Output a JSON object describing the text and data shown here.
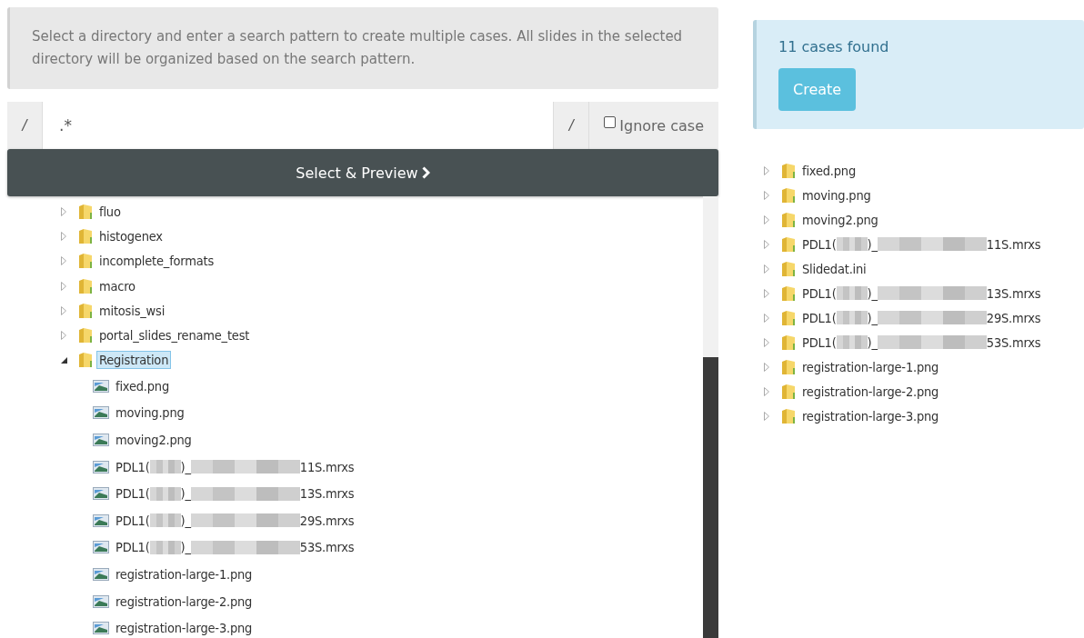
{
  "intro": {
    "text": "Select a directory and enter a search pattern to create multiple cases. All slides in the selected directory will be organized based on the search pattern."
  },
  "pattern": {
    "prefix": "/",
    "value": ".*",
    "suffix": "/",
    "ignore_case": {
      "label": "Ignore case",
      "checked": false
    }
  },
  "preview_button": {
    "label": "Select & Preview"
  },
  "directory_tree": [
    {
      "kind": "folder",
      "parts": [
        "fluo"
      ],
      "expanded": false,
      "selected": false
    },
    {
      "kind": "folder",
      "parts": [
        "histogenex"
      ],
      "expanded": false,
      "selected": false
    },
    {
      "kind": "folder",
      "parts": [
        "incomplete_formats"
      ],
      "expanded": false,
      "selected": false
    },
    {
      "kind": "folder",
      "parts": [
        "macro"
      ],
      "expanded": false,
      "selected": false
    },
    {
      "kind": "folder",
      "parts": [
        "mitosis_wsi"
      ],
      "expanded": false,
      "selected": false
    },
    {
      "kind": "folder",
      "parts": [
        "portal_slides_rename_test"
      ],
      "expanded": false,
      "selected": false
    },
    {
      "kind": "folder",
      "parts": [
        "Registration"
      ],
      "expanded": true,
      "selected": true,
      "children": [
        {
          "kind": "file",
          "parts": [
            "fixed.png"
          ],
          "selected": false
        },
        {
          "kind": "file",
          "parts": [
            "moving.png"
          ],
          "selected": false
        },
        {
          "kind": "file",
          "parts": [
            "moving2.png"
          ],
          "selected": false
        },
        {
          "kind": "file",
          "parts": [
            "PDL1(",
            ")_",
            "11S.mrxs"
          ],
          "selected": false
        },
        {
          "kind": "file",
          "parts": [
            "PDL1(",
            ")_",
            "13S.mrxs"
          ],
          "selected": false
        },
        {
          "kind": "file",
          "parts": [
            "PDL1(",
            ")_",
            "29S.mrxs"
          ],
          "selected": false
        },
        {
          "kind": "file",
          "parts": [
            "PDL1(",
            ")_",
            "53S.mrxs"
          ],
          "selected": false
        },
        {
          "kind": "file",
          "parts": [
            "registration-large-1.png"
          ],
          "selected": false
        },
        {
          "kind": "file",
          "parts": [
            "registration-large-2.png"
          ],
          "selected": false
        },
        {
          "kind": "file",
          "parts": [
            "registration-large-3.png"
          ],
          "selected": false
        }
      ]
    }
  ],
  "result": {
    "message": "11 cases found",
    "create_button": "Create"
  },
  "cases": [
    {
      "kind": "folder",
      "parts": [
        "fixed.png"
      ],
      "expanded": false,
      "selected": false
    },
    {
      "kind": "folder",
      "parts": [
        "moving.png"
      ],
      "expanded": false,
      "selected": false
    },
    {
      "kind": "folder",
      "parts": [
        "moving2.png"
      ],
      "expanded": false,
      "selected": false
    },
    {
      "kind": "folder",
      "parts": [
        "PDL1(",
        ")_",
        "11S.mrxs"
      ],
      "expanded": false,
      "selected": false
    },
    {
      "kind": "folder",
      "parts": [
        "Slidedat.ini"
      ],
      "expanded": false,
      "selected": false
    },
    {
      "kind": "folder",
      "parts": [
        "PDL1(",
        ")_",
        "13S.mrxs"
      ],
      "expanded": false,
      "selected": false
    },
    {
      "kind": "folder",
      "parts": [
        "PDL1(",
        ")_",
        "29S.mrxs"
      ],
      "expanded": false,
      "selected": false
    },
    {
      "kind": "folder",
      "parts": [
        "PDL1(",
        ")_",
        "53S.mrxs"
      ],
      "expanded": false,
      "selected": false
    },
    {
      "kind": "folder",
      "parts": [
        "registration-large-1.png"
      ],
      "expanded": false,
      "selected": false
    },
    {
      "kind": "folder",
      "parts": [
        "registration-large-2.png"
      ],
      "expanded": false,
      "selected": false
    },
    {
      "kind": "folder",
      "parts": [
        "registration-large-3.png"
      ],
      "expanded": false,
      "selected": false
    }
  ]
}
